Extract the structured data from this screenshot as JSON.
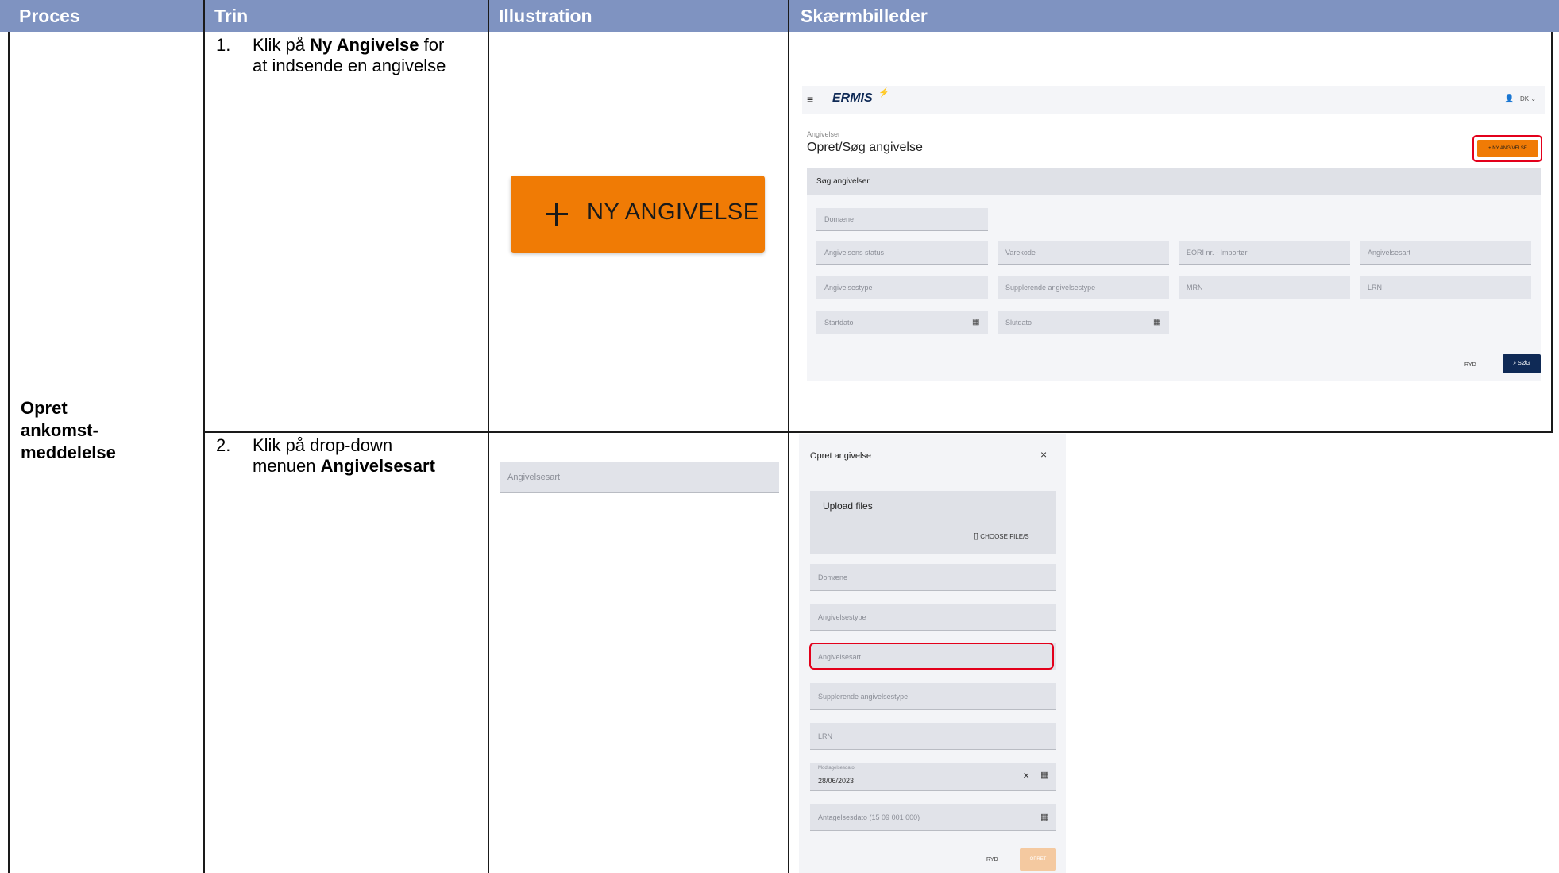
{
  "headers": [
    "Proces",
    "Trin",
    "Illustration",
    "Skærmbilleder"
  ],
  "process_label": "Opret ankomst-meddelelse",
  "process_lines": [
    "Opret",
    "ankomst-",
    "meddelelse"
  ],
  "step1": {
    "num": "1.",
    "pre": "Klik på ",
    "bold": "Ny Angivelse",
    "post": " for",
    "line2": "at indsende en angivelse"
  },
  "step2": {
    "num": "2.",
    "line1": "Klik på drop-down",
    "pre2": "menuen ",
    "bold": "Angivelsesart"
  },
  "illustration1": {
    "label": "NY ANGIVELSE"
  },
  "illustration2": {
    "label": "Angivelsesart"
  },
  "shot1": {
    "logo": "ERMIS",
    "lang": "DK",
    "breadcrumb": "Angivelser",
    "title": "Opret/Søg angivelse",
    "new_button": "NY ANGIVELSE",
    "panel_title": "Søg angivelser",
    "fields": {
      "domaene": "Domæne",
      "status": "Angivelsens status",
      "varekode": "Varekode",
      "eori": "EORI nr. - Importør",
      "art": "Angivelsesart",
      "type": "Angivelsestype",
      "supp": "Supplerende angivelsestype",
      "mrn": "MRN",
      "lrn": "LRN",
      "start": "Startdato",
      "slut": "Slutdato"
    },
    "clear": "RYD",
    "search": "SØG"
  },
  "shot2": {
    "title": "Opret angivelse",
    "upload_title": "Upload files",
    "choose": "CHOOSE FILE/S",
    "domaene": "Domæne",
    "type": "Angivelsestype",
    "art": "Angivelsesart",
    "supp": "Supplerende angivelsestype",
    "lrn": "LRN",
    "date_label": "Modtagelsesdato",
    "date_value": "28/06/2023",
    "antagelse": "Antagelsesdato (15 09 001 000)",
    "clear": "RYD",
    "create": "OPRET"
  },
  "colors": {
    "header": "#7f93c1",
    "orange": "#f07b05",
    "navy": "#0f2a56",
    "highlight": "#e3001b"
  }
}
